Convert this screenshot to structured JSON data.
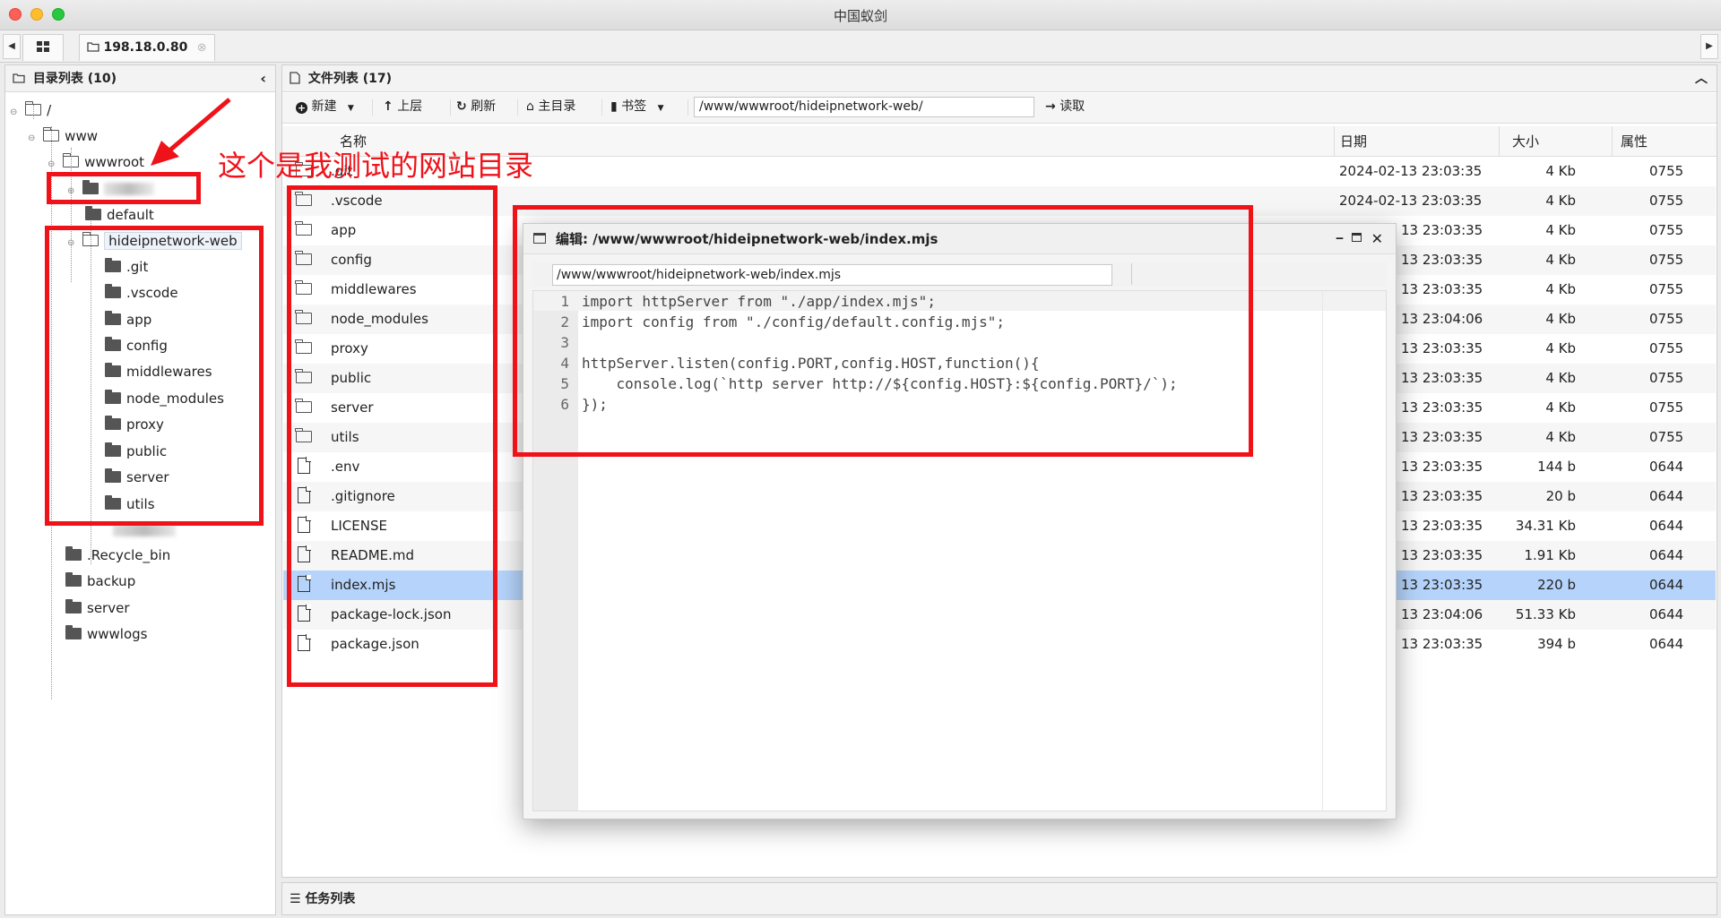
{
  "window": {
    "title": "中国蚁剑"
  },
  "tabs": {
    "connection_label": "198.18.0.80"
  },
  "dir_panel": {
    "title": "目录列表 (10)",
    "tree": [
      {
        "label": "/"
      },
      {
        "label": "www"
      },
      {
        "label": "wwwroot"
      },
      {
        "label": ""
      },
      {
        "label": "default"
      },
      {
        "label": "hideipnetwork-web"
      },
      {
        "label": ".git"
      },
      {
        "label": ".vscode"
      },
      {
        "label": "app"
      },
      {
        "label": "config"
      },
      {
        "label": "middlewares"
      },
      {
        "label": "node_modules"
      },
      {
        "label": "proxy"
      },
      {
        "label": "public"
      },
      {
        "label": "server"
      },
      {
        "label": "utils"
      },
      {
        "label": ".Recycle_bin"
      },
      {
        "label": "backup"
      },
      {
        "label": "server"
      },
      {
        "label": "wwwlogs"
      }
    ]
  },
  "file_panel": {
    "title": "文件列表 (17)",
    "toolbar": {
      "new": "新建",
      "up": "上层",
      "refresh": "刷新",
      "home": "主目录",
      "bookmark": "书签",
      "path": "/www/wwwroot/hideipnetwork-web/",
      "read": "读取"
    },
    "columns": {
      "name": "名称",
      "date": "日期",
      "size": "大小",
      "attr": "属性"
    },
    "rows": [
      {
        "name": ".git",
        "date": "2024-02-13 23:03:35",
        "size": "4 Kb",
        "attr": "0755"
      },
      {
        "name": ".vscode",
        "date": "2024-02-13 23:03:35",
        "size": "4 Kb",
        "attr": "0755"
      },
      {
        "name": "app",
        "date": "13 23:03:35",
        "size": "4 Kb",
        "attr": "0755"
      },
      {
        "name": "config",
        "date": "13 23:03:35",
        "size": "4 Kb",
        "attr": "0755"
      },
      {
        "name": "middlewares",
        "date": "13 23:03:35",
        "size": "4 Kb",
        "attr": "0755"
      },
      {
        "name": "node_modules",
        "date": "13 23:04:06",
        "size": "4 Kb",
        "attr": "0755"
      },
      {
        "name": "proxy",
        "date": "13 23:03:35",
        "size": "4 Kb",
        "attr": "0755"
      },
      {
        "name": "public",
        "date": "13 23:03:35",
        "size": "4 Kb",
        "attr": "0755"
      },
      {
        "name": "server",
        "date": "13 23:03:35",
        "size": "4 Kb",
        "attr": "0755"
      },
      {
        "name": "utils",
        "date": "13 23:03:35",
        "size": "4 Kb",
        "attr": "0755"
      },
      {
        "name": ".env",
        "date": "13 23:03:35",
        "size": "144 b",
        "attr": "0644"
      },
      {
        "name": ".gitignore",
        "date": "13 23:03:35",
        "size": "20 b",
        "attr": "0644"
      },
      {
        "name": "LICENSE",
        "date": "13 23:03:35",
        "size": "34.31 Kb",
        "attr": "0644"
      },
      {
        "name": "README.md",
        "date": "13 23:03:35",
        "size": "1.91 Kb",
        "attr": "0644"
      },
      {
        "name": "index.mjs",
        "date": "13 23:03:35",
        "size": "220 b",
        "attr": "0644"
      },
      {
        "name": "package-lock.json",
        "date": "13 23:04:06",
        "size": "51.33 Kb",
        "attr": "0644"
      },
      {
        "name": "package.json",
        "date": "13 23:03:35",
        "size": "394 b",
        "attr": "0644"
      }
    ]
  },
  "editor": {
    "title": "编辑: /www/wwwroot/hideipnetwork-web/index.mjs",
    "path": "/www/wwwroot/hideipnetwork-web/index.mjs",
    "lines": [
      {
        "n": "1",
        "code": "import httpServer from \"./app/index.mjs\";"
      },
      {
        "n": "2",
        "code": "import config from \"./config/default.config.mjs\";"
      },
      {
        "n": "3",
        "code": ""
      },
      {
        "n": "4",
        "code": "httpServer.listen(config.PORT,config.HOST,function(){"
      },
      {
        "n": "5",
        "code": "    console.log(`http server http://${config.HOST}:${config.PORT}/`);"
      },
      {
        "n": "6",
        "code": "});"
      }
    ]
  },
  "annotation": {
    "text": "这个是我测试的网站目录",
    "color": "#ef1219"
  },
  "task_panel": {
    "title": "任务列表"
  },
  "colors": {
    "selected_row": "#b6d4fb",
    "annotation_red": "#ef1219"
  }
}
